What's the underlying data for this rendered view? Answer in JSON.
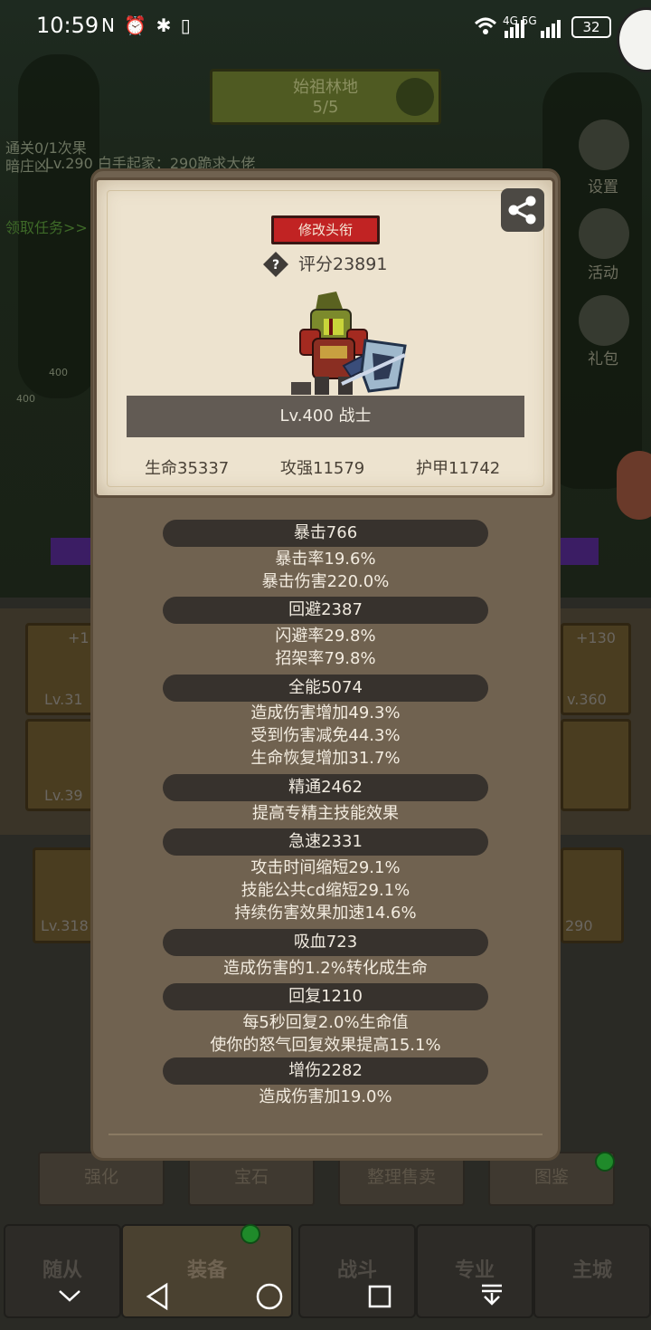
{
  "status_bar": {
    "time": "10:59",
    "left_icons": "N ⏰ ✱ ▯",
    "right_icons": "4G 5G",
    "battery": "32"
  },
  "background": {
    "zone_name": "始祖林地",
    "zone_progress": "5/5",
    "line1": "通关0/1次果",
    "line2": "暗庄凶",
    "ticker": "Lv.290 白手起家：290跪求大佬",
    "task_link": "领取任务>>",
    "mini_levels": [
      "400",
      "400"
    ],
    "side_labels": [
      "设置",
      "活动",
      "礼包"
    ],
    "slots": [
      {
        "plus": "+1",
        "lv": "Lv.31"
      },
      {
        "plus": "",
        "lv": "Lv.39"
      },
      {
        "plus": "",
        "lv": "Lv.318"
      },
      {
        "plus": "+130",
        "lv": "v.360"
      },
      {
        "plus": "",
        "lv": "290"
      }
    ],
    "action_tabs": [
      "强化",
      "宝石",
      "整理售卖",
      "图鉴"
    ],
    "nav_tabs": [
      "随从",
      "装备",
      "战斗",
      "专业",
      "主城"
    ]
  },
  "modal": {
    "rename_label": "修改头衔",
    "score_help": "?",
    "score": "评分23891",
    "level_class": "Lv.400 战士",
    "hp": "生命35337",
    "atk": "攻强11579",
    "armor": "护甲11742",
    "sections": [
      {
        "title": "暴击766",
        "lines": [
          "暴击率19.6%",
          "暴击伤害220.0%"
        ]
      },
      {
        "title": "回避2387",
        "lines": [
          "闪避率29.8%",
          "招架率79.8%"
        ]
      },
      {
        "title": "全能5074",
        "lines": [
          "造成伤害增加49.3%",
          "受到伤害减免44.3%",
          "生命恢复增加31.7%"
        ]
      },
      {
        "title": "精通2462",
        "lines": [
          "提高专精主技能效果"
        ]
      },
      {
        "title": "急速2331",
        "lines": [
          "攻击时间缩短29.1%",
          "技能公共cd缩短29.1%",
          "持续伤害效果加速14.6%"
        ]
      },
      {
        "title": "吸血723",
        "lines": [
          "造成伤害的1.2%转化成生命"
        ]
      },
      {
        "title": "回复1210",
        "lines": [
          "每5秒回复2.0%生命值",
          "使你的怒气回复效果提高15.1%"
        ]
      },
      {
        "title": "增伤2282",
        "lines": [
          "造成伤害加19.0%"
        ]
      }
    ]
  },
  "colors": {
    "panel_brown": "#706250",
    "parchment": "#ede3cf",
    "rename_red": "#c12323",
    "section_bar": "#37322d"
  }
}
